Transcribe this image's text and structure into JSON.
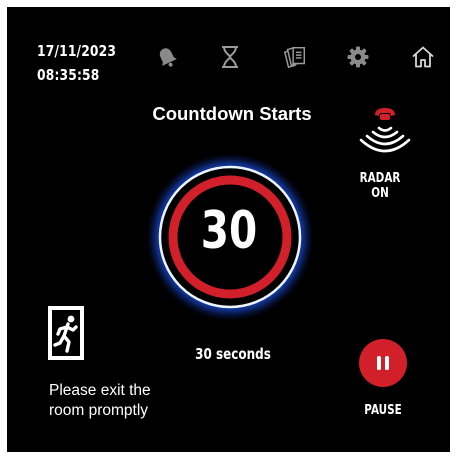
{
  "status": {
    "date": "17/11/2023",
    "time": "08:35:58"
  },
  "toolbar": {
    "icons": [
      "bell-icon",
      "hourglass-icon",
      "documents-icon",
      "gear-icon",
      "home-icon"
    ]
  },
  "countdown": {
    "title": "Countdown Starts",
    "value": "30",
    "caption": "30 seconds",
    "ring_color": "#d1202a",
    "glow_color": "#1a5cff"
  },
  "radar": {
    "label": "RADAR ON",
    "icon": "radar-phone-icon",
    "color": "#d1202a"
  },
  "exit": {
    "icon": "emergency-exit-icon",
    "message_line1": "Please exit the",
    "message_line2": "room promptly"
  },
  "pause": {
    "label": "PAUSE",
    "icon": "pause-icon",
    "color": "#d1202a"
  }
}
